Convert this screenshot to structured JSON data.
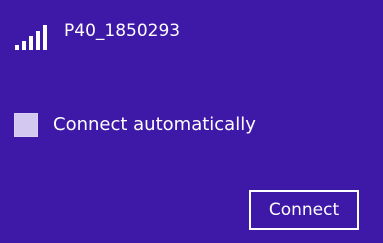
{
  "network": {
    "name": "P40_1850293",
    "signal_icon": "wifi-signal-bars-icon",
    "signal_strength_bars": 5
  },
  "options": {
    "connect_automatically_label": "Connect automatically",
    "connect_automatically_checked": false
  },
  "actions": {
    "connect_label": "Connect"
  },
  "colors": {
    "background": "#3e19a7",
    "text": "#ffffff",
    "checkbox_fill": "#d3c8ef"
  }
}
